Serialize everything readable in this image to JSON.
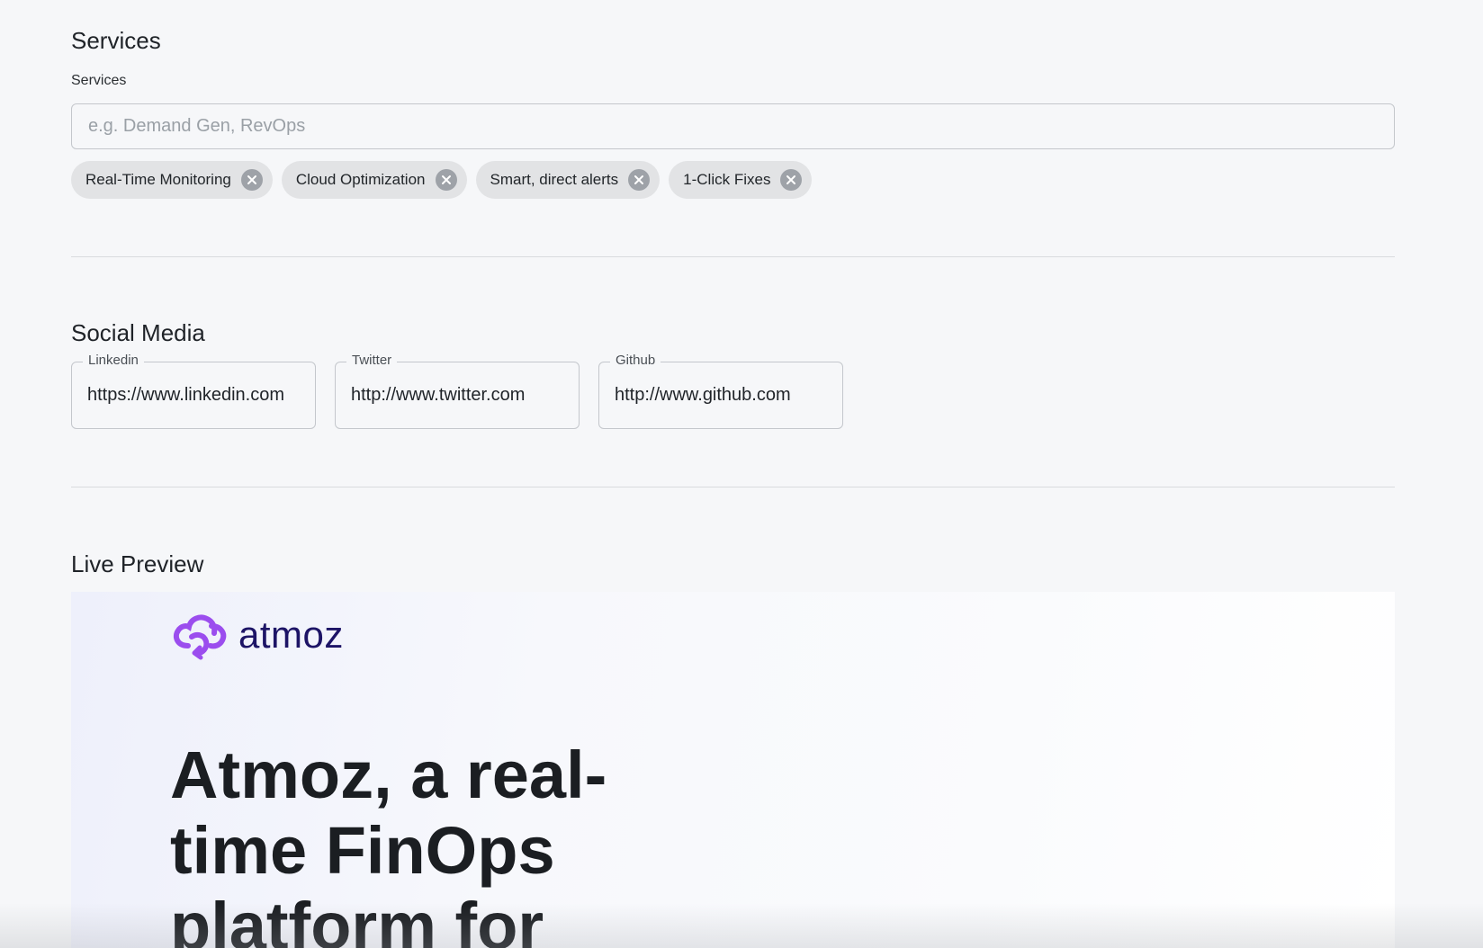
{
  "services": {
    "title": "Services",
    "label": "Services",
    "placeholder": "e.g. Demand Gen, RevOps",
    "chips": [
      {
        "label": "Real-Time Monitoring"
      },
      {
        "label": "Cloud Optimization"
      },
      {
        "label": "Smart, direct alerts"
      },
      {
        "label": "1-Click Fixes"
      }
    ]
  },
  "social": {
    "title": "Social Media",
    "fields": [
      {
        "label": "Linkedin",
        "value": "https://www.linkedin.com"
      },
      {
        "label": "Twitter",
        "value": "http://www.twitter.com"
      },
      {
        "label": "Github",
        "value": "http://www.github.com"
      }
    ]
  },
  "preview": {
    "title": "Live Preview",
    "brand": "atmoz",
    "hero_line1": "Atmoz, a real-",
    "hero_line2": "time FinOps",
    "hero_line3": "platform for"
  },
  "colors": {
    "background": "#f6f7f9",
    "chip": "#e2e3e5",
    "brand_purple": "#9b4dee",
    "brand_navy": "#1d1466"
  }
}
